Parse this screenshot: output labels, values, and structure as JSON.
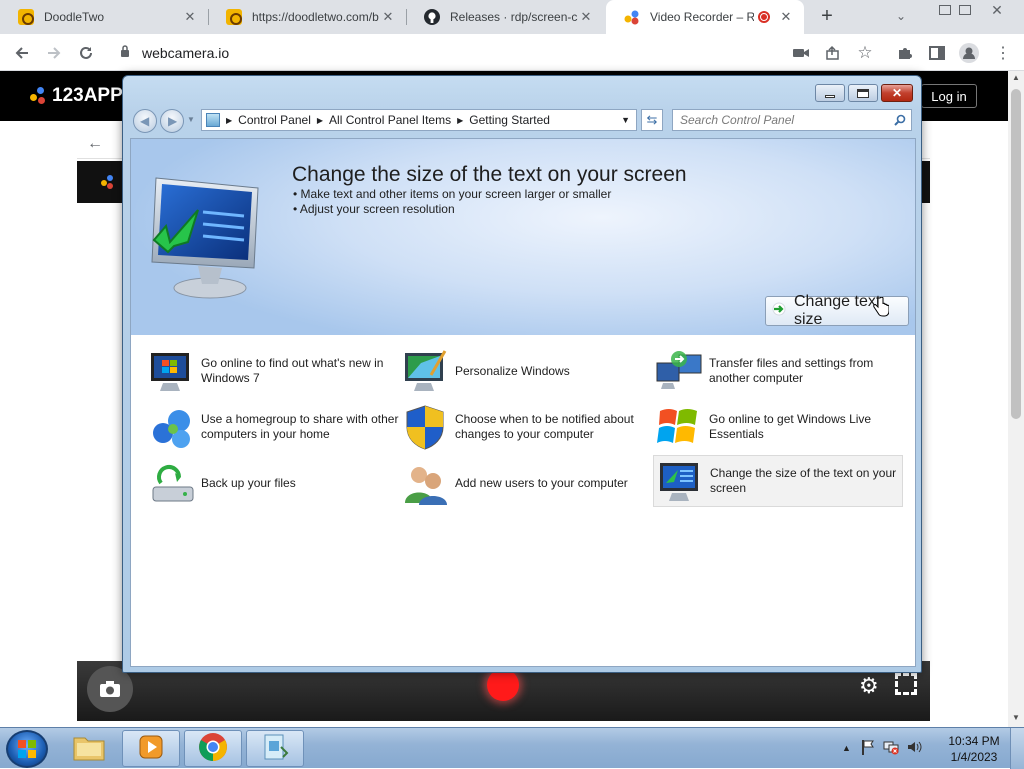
{
  "browser": {
    "tabs": [
      {
        "title": "DoodleTwo",
        "active": false
      },
      {
        "title": "https://doodletwo.com/b",
        "active": false
      },
      {
        "title": "Releases · rdp/screen-cap",
        "active": false
      },
      {
        "title": "Video Recorder – Rec",
        "active": true
      }
    ],
    "new_tab_label": "+",
    "address": "webcamera.io"
  },
  "site": {
    "logo_text": "123APP",
    "login_label": "Log in"
  },
  "control_panel": {
    "breadcrumbs": [
      "Control Panel",
      "All Control Panel Items",
      "Getting Started"
    ],
    "search_placeholder": "Search Control Panel",
    "hero": {
      "title": "Change the size of the text on your screen",
      "bullets": [
        "Make text and other items on your screen larger or smaller",
        "Adjust your screen resolution"
      ],
      "action_label": "Change text size"
    },
    "tasks": [
      {
        "label": "Go online to find out what's new in Windows 7",
        "icon": "windows-monitor-icon"
      },
      {
        "label": "Personalize Windows",
        "icon": "personalize-icon"
      },
      {
        "label": "Transfer files and settings from another computer",
        "icon": "transfer-icon"
      },
      {
        "label": "Use a homegroup to share with other computers in your home",
        "icon": "homegroup-icon"
      },
      {
        "label": "Choose when to be notified about changes to your computer",
        "icon": "uac-shield-icon"
      },
      {
        "label": "Go online to get Windows Live Essentials",
        "icon": "windows-flag-icon"
      },
      {
        "label": "Back up your files",
        "icon": "backup-icon"
      },
      {
        "label": "Add new users to your computer",
        "icon": "users-icon"
      },
      {
        "label": "Change the size of the text on your screen",
        "icon": "display-text-size-icon",
        "selected": true
      }
    ]
  },
  "taskbar": {
    "time": "10:34 PM",
    "date": "1/4/2023"
  }
}
